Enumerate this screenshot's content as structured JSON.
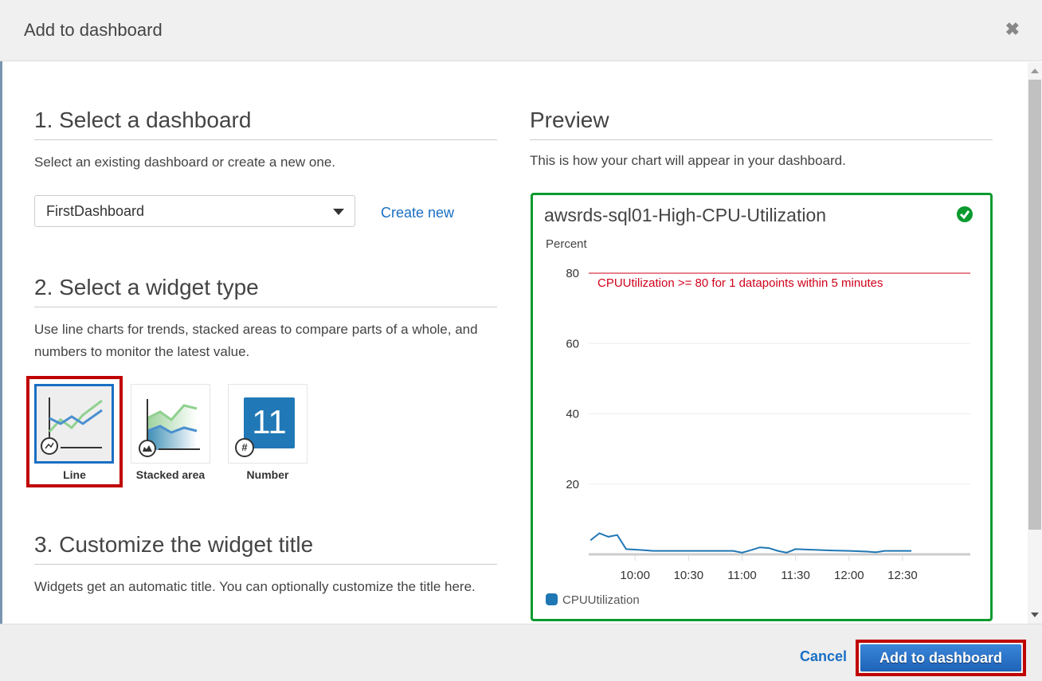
{
  "dialog": {
    "title": "Add to dashboard",
    "close_icon": "close-icon"
  },
  "section1": {
    "heading": "1. Select a dashboard",
    "description": "Select an existing dashboard or create a new one.",
    "selected_dashboard": "FirstDashboard",
    "create_new_label": "Create new"
  },
  "section2": {
    "heading": "2. Select a widget type",
    "description": "Use line charts for trends, stacked areas to compare parts of a whole, and numbers to monitor the latest value.",
    "widgets": [
      {
        "label": "Line",
        "selected": true
      },
      {
        "label": "Stacked area",
        "selected": false
      },
      {
        "label": "Number",
        "selected": false,
        "sample_value": "11"
      }
    ]
  },
  "section3": {
    "heading": "3. Customize the widget title",
    "description": "Widgets get an automatic title. You can optionally customize the title here."
  },
  "preview": {
    "heading": "Preview",
    "description": "This is how your chart will appear in your dashboard.",
    "card_title": "awsrds-sql01-High-CPU-Utilization",
    "status": "ok"
  },
  "chart_data": {
    "type": "line",
    "title": "awsrds-sql01-High-CPU-Utilization",
    "ylabel": "Percent",
    "xlabel": "",
    "ylim": [
      0,
      80
    ],
    "yticks": [
      "80",
      "60",
      "40",
      "20"
    ],
    "ytick_values": [
      80,
      60,
      40,
      20
    ],
    "xticks": [
      "10:00",
      "10:30",
      "11:00",
      "11:30",
      "12:00",
      "12:30"
    ],
    "xtick_minutes": [
      600,
      630,
      660,
      690,
      720,
      750
    ],
    "xlim_minutes": [
      574,
      788
    ],
    "threshold": {
      "value": 80,
      "label": "CPUUtilization >= 80 for 1 datapoints within 5 minutes",
      "color": "#d0021b"
    },
    "series": [
      {
        "name": "CPUUtilization",
        "color": "#1f77b4",
        "x_minutes": [
          575,
          580,
          585,
          590,
          595,
          605,
          610,
          620,
          630,
          640,
          650,
          655,
          660,
          665,
          670,
          675,
          680,
          685,
          690,
          700,
          710,
          720,
          730,
          735,
          740,
          745,
          750,
          755
        ],
        "values": [
          4,
          6,
          5,
          5.5,
          1.5,
          1.2,
          1.0,
          1.0,
          1.0,
          1.0,
          1.0,
          1.0,
          0.5,
          1.2,
          2.0,
          1.8,
          1.0,
          0.5,
          1.5,
          1.3,
          1.1,
          1.0,
          0.8,
          0.6,
          1.0,
          1.0,
          1.0,
          1.0
        ]
      }
    ]
  },
  "footer": {
    "cancel_label": "Cancel",
    "submit_label": "Add to dashboard"
  },
  "colors": {
    "accent": "#1a6fc4",
    "highlight": "#c00000",
    "ok": "#0a9a2e"
  }
}
